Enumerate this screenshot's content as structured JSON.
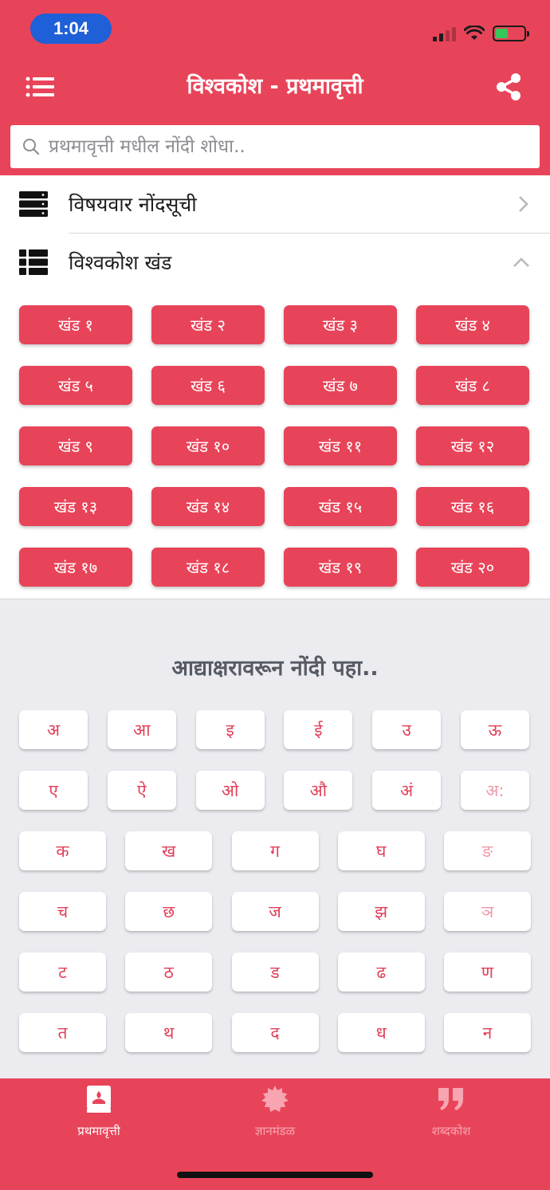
{
  "status": {
    "time": "1:04"
  },
  "header": {
    "title": "विश्वकोश - प्रथमावृत्ती"
  },
  "search": {
    "placeholder": "प्रथमावृत्ती मधील नोंदी शोधा.."
  },
  "rows": {
    "topics": "विषयवार नोंदसूची",
    "volumes": "विश्वकोश खंड"
  },
  "khand": [
    "खंड १",
    "खंड २",
    "खंड ३",
    "खंड ४",
    "खंड ५",
    "खंड ६",
    "खंड ७",
    "खंड ८",
    "खंड ९",
    "खंड १०",
    "खंड ११",
    "खंड १२",
    "खंड १३",
    "खंड १४",
    "खंड १५",
    "खंड १६",
    "खंड १७",
    "खंड १८",
    "खंड १९",
    "खंड २०"
  ],
  "letters_title": "आद्याक्षरावरून नोंदी पहा..",
  "vowels": [
    "अ",
    "आ",
    "इ",
    "ई",
    "उ",
    "ऊ",
    "ए",
    "ऐ",
    "ओ",
    "औ",
    "अं",
    "अ:"
  ],
  "consonants": [
    "क",
    "ख",
    "ग",
    "घ",
    "ङ",
    "च",
    "छ",
    "ज",
    "झ",
    "ञ",
    "ट",
    "ठ",
    "ड",
    "ढ",
    "ण",
    "त",
    "थ",
    "द",
    "ध",
    "न"
  ],
  "bottom_nav": [
    {
      "label": "प्रथमावृत्ती",
      "icon": "book-icon",
      "active": true
    },
    {
      "label": "ज्ञानमंडळ",
      "icon": "badge-icon",
      "active": false
    },
    {
      "label": "शब्दकोश",
      "icon": "quote-icon",
      "active": false
    }
  ],
  "colors": {
    "brand": "#e84459",
    "letter_text": "#e0405a",
    "background": "#ebebf0"
  }
}
